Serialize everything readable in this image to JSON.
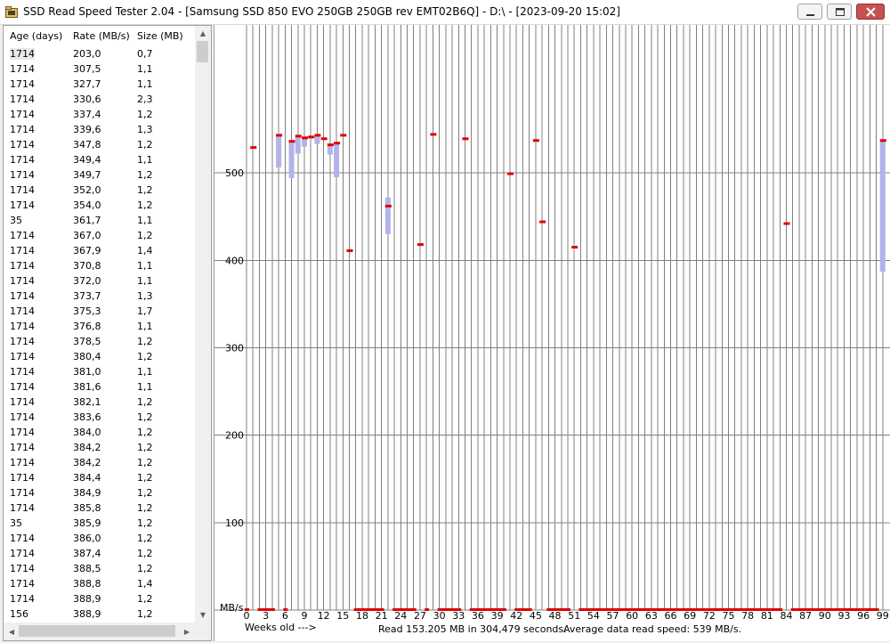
{
  "window": {
    "title": "SSD Read Speed Tester 2.04 - [Samsung SSD 850 EVO 250GB 250GB rev EMT02B6Q] - D:\\ - [2023-09-20 15:02]",
    "icons": {
      "app": "folder-disk-icon",
      "minimize": "minimize-icon",
      "maximize": "maximize-icon",
      "close": "close-icon"
    }
  },
  "list": {
    "columns": [
      "Age (days)",
      "Rate (MB/s)",
      "Size (MB)"
    ],
    "rows": [
      [
        "1714",
        "203,0",
        "0,7"
      ],
      [
        "1714",
        "307,5",
        "1,1"
      ],
      [
        "1714",
        "327,7",
        "1,1"
      ],
      [
        "1714",
        "330,6",
        "2,3"
      ],
      [
        "1714",
        "337,4",
        "1,2"
      ],
      [
        "1714",
        "339,6",
        "1,3"
      ],
      [
        "1714",
        "347,8",
        "1,2"
      ],
      [
        "1714",
        "349,4",
        "1,1"
      ],
      [
        "1714",
        "349,7",
        "1,2"
      ],
      [
        "1714",
        "352,0",
        "1,2"
      ],
      [
        "1714",
        "354,0",
        "1,2"
      ],
      [
        "35",
        "361,7",
        "1,1"
      ],
      [
        "1714",
        "367,0",
        "1,2"
      ],
      [
        "1714",
        "367,9",
        "1,4"
      ],
      [
        "1714",
        "370,8",
        "1,1"
      ],
      [
        "1714",
        "372,0",
        "1,1"
      ],
      [
        "1714",
        "373,7",
        "1,3"
      ],
      [
        "1714",
        "375,3",
        "1,7"
      ],
      [
        "1714",
        "376,8",
        "1,1"
      ],
      [
        "1714",
        "378,5",
        "1,2"
      ],
      [
        "1714",
        "380,4",
        "1,2"
      ],
      [
        "1714",
        "381,0",
        "1,1"
      ],
      [
        "1714",
        "381,6",
        "1,1"
      ],
      [
        "1714",
        "382,1",
        "1,2"
      ],
      [
        "1714",
        "383,6",
        "1,2"
      ],
      [
        "1714",
        "384,0",
        "1,2"
      ],
      [
        "1714",
        "384,2",
        "1,2"
      ],
      [
        "1714",
        "384,2",
        "1,2"
      ],
      [
        "1714",
        "384,4",
        "1,2"
      ],
      [
        "1714",
        "384,9",
        "1,2"
      ],
      [
        "1714",
        "385,8",
        "1,2"
      ],
      [
        "35",
        "385,9",
        "1,2"
      ],
      [
        "1714",
        "386,0",
        "1,2"
      ],
      [
        "1714",
        "387,4",
        "1,2"
      ],
      [
        "1714",
        "388,5",
        "1,2"
      ],
      [
        "1714",
        "388,8",
        "1,4"
      ],
      [
        "1714",
        "388,9",
        "1,2"
      ],
      [
        "156",
        "388,9",
        "1,2"
      ]
    ],
    "selected_row": 0
  },
  "chart_data": {
    "type": "scatter",
    "xlabel": "Weeks old --->",
    "ylabel": "MB/s",
    "x_ticks": [
      0,
      3,
      6,
      9,
      12,
      15,
      18,
      21,
      24,
      27,
      30,
      33,
      36,
      39,
      42,
      45,
      48,
      51,
      54,
      57,
      60,
      63,
      66,
      69,
      72,
      75,
      78,
      81,
      84,
      87,
      90,
      93,
      96,
      99
    ],
    "y_ticks": [
      100,
      200,
      300,
      400,
      500
    ],
    "ylim": [
      0,
      605
    ],
    "xlim": [
      0,
      99
    ],
    "grid": true,
    "series": [
      {
        "points": [
          {
            "x": 1,
            "avg": 529,
            "min": 529,
            "max": 529
          },
          {
            "x": 5,
            "avg": 543,
            "min": 506,
            "max": 543
          },
          {
            "x": 7,
            "avg": 536,
            "min": 494,
            "max": 536
          },
          {
            "x": 8,
            "avg": 542,
            "min": 522,
            "max": 542
          },
          {
            "x": 9,
            "avg": 540,
            "min": 530,
            "max": 540
          },
          {
            "x": 10,
            "avg": 541,
            "min": 541,
            "max": 541
          },
          {
            "x": 11,
            "avg": 543,
            "min": 533,
            "max": 543
          },
          {
            "x": 12,
            "avg": 539,
            "min": 539,
            "max": 539
          },
          {
            "x": 13,
            "avg": 532,
            "min": 521,
            "max": 532
          },
          {
            "x": 14,
            "avg": 534,
            "min": 495,
            "max": 534
          },
          {
            "x": 15,
            "avg": 543,
            "min": 543,
            "max": 543
          },
          {
            "x": 16,
            "avg": 411,
            "min": 411,
            "max": 411
          },
          {
            "x": 22,
            "avg": 462,
            "min": 430,
            "max": 472
          },
          {
            "x": 27,
            "avg": 418,
            "min": 418,
            "max": 418
          },
          {
            "x": 29,
            "avg": 544,
            "min": 544,
            "max": 544
          },
          {
            "x": 34,
            "avg": 539,
            "min": 539,
            "max": 539
          },
          {
            "x": 41,
            "avg": 499,
            "min": 499,
            "max": 499
          },
          {
            "x": 45,
            "avg": 537,
            "min": 537,
            "max": 537
          },
          {
            "x": 46,
            "avg": 444,
            "min": 444,
            "max": 444
          },
          {
            "x": 51,
            "avg": 415,
            "min": 415,
            "max": 415
          },
          {
            "x": 84,
            "avg": 442,
            "min": 442,
            "max": 442
          },
          {
            "x": 99,
            "avg": 537,
            "min": 387,
            "max": 537
          }
        ]
      }
    ],
    "baseline_ranges": [
      [
        0,
        0
      ],
      [
        2,
        4
      ],
      [
        6,
        6
      ],
      [
        17,
        21
      ],
      [
        23,
        26
      ],
      [
        28,
        28
      ],
      [
        30,
        33
      ],
      [
        35,
        40
      ],
      [
        42,
        44
      ],
      [
        47,
        50
      ],
      [
        52,
        83
      ],
      [
        85,
        98
      ]
    ],
    "colors": {
      "avg": "#e00000",
      "range": "#b3b3ea",
      "grid": "#808080"
    }
  },
  "footer": {
    "weeks_label": "Weeks old --->",
    "read_summary": "Read 153.205 MB in 304,479 seconds.",
    "avg_speed": "Average data read speed: 539 MB/s."
  }
}
